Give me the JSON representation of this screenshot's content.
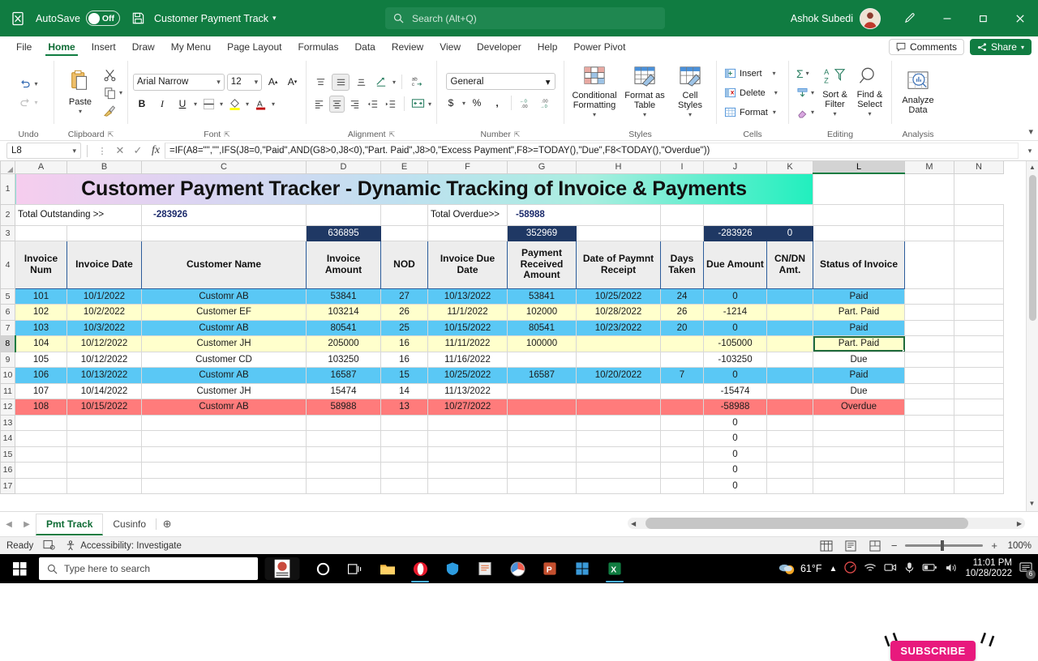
{
  "titlebar": {
    "autosave_label": "AutoSave",
    "autosave_state": "Off",
    "doc_title": "Customer Payment Track",
    "search_placeholder": "Search (Alt+Q)",
    "user_name": "Ashok Subedi"
  },
  "ribbon": {
    "tabs": [
      {
        "label": "File"
      },
      {
        "label": "Home"
      },
      {
        "label": "Insert"
      },
      {
        "label": "Draw"
      },
      {
        "label": "My Menu"
      },
      {
        "label": "Page Layout"
      },
      {
        "label": "Formulas"
      },
      {
        "label": "Data"
      },
      {
        "label": "Review"
      },
      {
        "label": "View"
      },
      {
        "label": "Developer"
      },
      {
        "label": "Help"
      },
      {
        "label": "Power Pivot"
      }
    ],
    "active_tab": "Home",
    "comments_label": "Comments",
    "share_label": "Share",
    "groups": {
      "undo": {
        "name": "Undo"
      },
      "clipboard": {
        "name": "Clipboard",
        "paste_label": "Paste"
      },
      "font": {
        "name": "Font",
        "font_family": "Arial Narrow",
        "font_size": "12"
      },
      "alignment": {
        "name": "Alignment"
      },
      "number": {
        "name": "Number",
        "format": "General"
      },
      "styles": {
        "name": "Styles",
        "conditional_formatting": "Conditional Formatting",
        "format_as_table": "Format as Table",
        "cell_styles": "Cell Styles"
      },
      "cells": {
        "name": "Cells",
        "insert": "Insert",
        "delete": "Delete",
        "format": "Format"
      },
      "editing": {
        "name": "Editing",
        "sort_filter": "Sort & Filter",
        "find_select": "Find & Select"
      },
      "analysis": {
        "name": "Analysis",
        "analyze_data": "Analyze Data"
      }
    }
  },
  "formula_bar": {
    "name_box": "L8",
    "formula": "=IF(A8=\"\",\"\",IFS(J8=0,\"Paid\",AND(G8>0,J8<0),\"Part. Paid\",J8>0,\"Excess Payment\",F8>=TODAY(),\"Due\",F8<TODAY(),\"Overdue\"))"
  },
  "grid": {
    "columns": [
      "A",
      "B",
      "C",
      "D",
      "E",
      "F",
      "G",
      "H",
      "I",
      "J",
      "K",
      "L",
      "M",
      "N"
    ],
    "selected_column": "L",
    "selected_row": "8",
    "row_numbers": [
      "1",
      "2",
      "3",
      "4",
      "5",
      "6",
      "7",
      "8",
      "9",
      "10",
      "11",
      "12",
      "13",
      "14",
      "15",
      "16",
      "17"
    ],
    "title": "Customer Payment Tracker - Dynamic Tracking of Invoice & Payments",
    "summary": {
      "total_outstanding_label": "Total Outstanding >>",
      "total_outstanding_value": "-283926",
      "total_overdue_label": "Total Overdue>>",
      "total_overdue_value": "-58988"
    },
    "totals_row": {
      "invoice_amount_total": "636895",
      "payment_received_total": "352969",
      "due_amount_total": "-283926",
      "cn_dn_total": "0"
    },
    "headers": [
      "Invoice Num",
      "Invoice Date",
      "Customer Name",
      "Invoice Amount",
      "NOD",
      "Invoice Due Date",
      "Payment Received Amount",
      "Date of Paymnt Receipt",
      "Days Taken",
      "Due Amount",
      "CN/DN Amt.",
      "Status of Invoice"
    ],
    "rows": [
      {
        "row": "5",
        "style": "rowBlue",
        "num": "101",
        "date": "10/1/2022",
        "customer": "Customr AB",
        "amount": "53841",
        "nod": "27",
        "due_date": "10/13/2022",
        "received": "53841",
        "receipt_date": "10/25/2022",
        "days": "24",
        "due_amount": "0",
        "cn_dn": "",
        "status": "Paid"
      },
      {
        "row": "6",
        "style": "rowYell",
        "num": "102",
        "date": "10/2/2022",
        "customer": "Customer EF",
        "amount": "103214",
        "nod": "26",
        "due_date": "11/1/2022",
        "received": "102000",
        "receipt_date": "10/28/2022",
        "days": "26",
        "due_amount": "-1214",
        "cn_dn": "",
        "status": "Part. Paid"
      },
      {
        "row": "7",
        "style": "rowBlue",
        "num": "103",
        "date": "10/3/2022",
        "customer": "Customr AB",
        "amount": "80541",
        "nod": "25",
        "due_date": "10/15/2022",
        "received": "80541",
        "receipt_date": "10/23/2022",
        "days": "20",
        "due_amount": "0",
        "cn_dn": "",
        "status": "Paid"
      },
      {
        "row": "8",
        "style": "rowYell",
        "num": "104",
        "date": "10/12/2022",
        "customer": "Customer JH",
        "amount": "205000",
        "nod": "16",
        "due_date": "11/11/2022",
        "received": "100000",
        "receipt_date": "",
        "days": "",
        "due_amount": "-105000",
        "cn_dn": "",
        "status": "Part. Paid"
      },
      {
        "row": "9",
        "style": "rowWhite",
        "num": "105",
        "date": "10/12/2022",
        "customer": "Customer CD",
        "amount": "103250",
        "nod": "16",
        "due_date": "11/16/2022",
        "received": "",
        "receipt_date": "",
        "days": "",
        "due_amount": "-103250",
        "cn_dn": "",
        "status": "Due"
      },
      {
        "row": "10",
        "style": "rowBlue",
        "num": "106",
        "date": "10/13/2022",
        "customer": "Customr AB",
        "amount": "16587",
        "nod": "15",
        "due_date": "10/25/2022",
        "received": "16587",
        "receipt_date": "10/20/2022",
        "days": "7",
        "due_amount": "0",
        "cn_dn": "",
        "status": "Paid"
      },
      {
        "row": "11",
        "style": "rowWhite",
        "num": "107",
        "date": "10/14/2022",
        "customer": "Customer JH",
        "amount": "15474",
        "nod": "14",
        "due_date": "11/13/2022",
        "received": "",
        "receipt_date": "",
        "days": "",
        "due_amount": "-15474",
        "cn_dn": "",
        "status": "Due"
      },
      {
        "row": "12",
        "style": "rowRed",
        "num": "108",
        "date": "10/15/2022",
        "customer": "Customr AB",
        "amount": "58988",
        "nod": "13",
        "due_date": "10/27/2022",
        "received": "",
        "receipt_date": "",
        "days": "",
        "due_amount": "-58988",
        "cn_dn": "",
        "status": "Overdue"
      },
      {
        "row": "13",
        "style": "rowWhite",
        "num": "",
        "date": "",
        "customer": "",
        "amount": "",
        "nod": "",
        "due_date": "",
        "received": "",
        "receipt_date": "",
        "days": "",
        "due_amount": "0",
        "cn_dn": "",
        "status": ""
      },
      {
        "row": "14",
        "style": "rowWhite",
        "num": "",
        "date": "",
        "customer": "",
        "amount": "",
        "nod": "",
        "due_date": "",
        "received": "",
        "receipt_date": "",
        "days": "",
        "due_amount": "0",
        "cn_dn": "",
        "status": ""
      },
      {
        "row": "15",
        "style": "rowWhite",
        "num": "",
        "date": "",
        "customer": "",
        "amount": "",
        "nod": "",
        "due_date": "",
        "received": "",
        "receipt_date": "",
        "days": "",
        "due_amount": "0",
        "cn_dn": "",
        "status": ""
      },
      {
        "row": "16",
        "style": "rowWhite",
        "num": "",
        "date": "",
        "customer": "",
        "amount": "",
        "nod": "",
        "due_date": "",
        "received": "",
        "receipt_date": "",
        "days": "",
        "due_amount": "0",
        "cn_dn": "",
        "status": ""
      },
      {
        "row": "17",
        "style": "rowWhite",
        "num": "",
        "date": "",
        "customer": "",
        "amount": "",
        "nod": "",
        "due_date": "",
        "received": "",
        "receipt_date": "",
        "days": "",
        "due_amount": "0",
        "cn_dn": "",
        "status": ""
      }
    ],
    "overlay": {
      "subscribe_label": "SUBSCRIBE"
    },
    "colors": {
      "paid_row": "#5ac8f5",
      "part_paid_row": "#ffffcc",
      "overdue_row": "#ff7b7b",
      "navy_band": "#1f3864",
      "accent_green": "#107c41",
      "subscribe_pink": "#e8197d"
    }
  },
  "sheet_tabs": {
    "tabs": [
      {
        "label": "Pmt Track"
      },
      {
        "label": "Cusinfo"
      }
    ],
    "active": "Pmt Track"
  },
  "status_bar": {
    "state": "Ready",
    "accessibility": "Accessibility: Investigate",
    "zoom": "100%"
  },
  "taskbar": {
    "search_placeholder": "Type here to search",
    "temperature": "61°F",
    "time": "11:01 PM",
    "date": "10/28/2022",
    "notification_count": "6"
  }
}
